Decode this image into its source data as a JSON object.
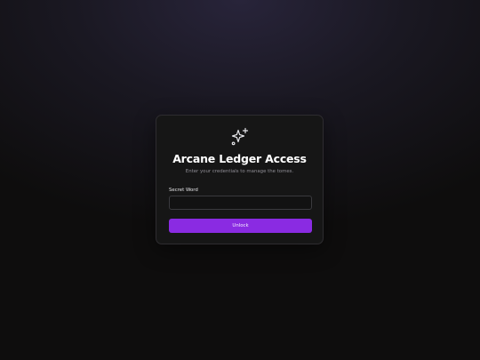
{
  "login_card": {
    "icon": "sparkles-icon",
    "title": "Arcane Ledger Access",
    "subtitle": "Enter your credentials to manage the tomes.",
    "secret_word_label": "Secret Word",
    "secret_word_value": "",
    "secret_word_placeholder": "",
    "unlock_label": "Unlock"
  },
  "colors": {
    "accent": "#8a2be2",
    "background": "#0e0d0d",
    "card": "#161616"
  }
}
